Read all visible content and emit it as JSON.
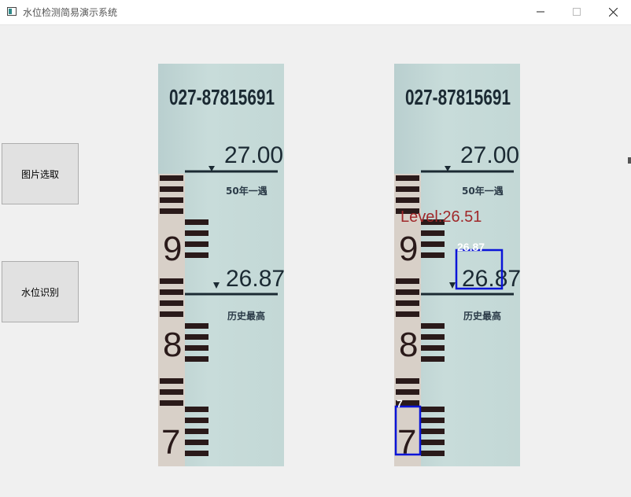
{
  "window": {
    "title": "水位检测简易演示系统"
  },
  "buttons": {
    "select_image": "图片选取",
    "recognize": "水位识别"
  },
  "gauge": {
    "phone": "027-87815691",
    "mark_upper": "27.00",
    "mark_upper_note": "50年一遇",
    "mark_lower": "26.87",
    "mark_lower_note": "历史最高",
    "digit_9": "9",
    "digit_8": "8",
    "digit_7": "7"
  },
  "result": {
    "level_text": "Level:26.51",
    "detection_1_label": "26.87",
    "detection_2_label": "7",
    "box_color": "#0a14d8",
    "level_color": "#a0282a"
  }
}
